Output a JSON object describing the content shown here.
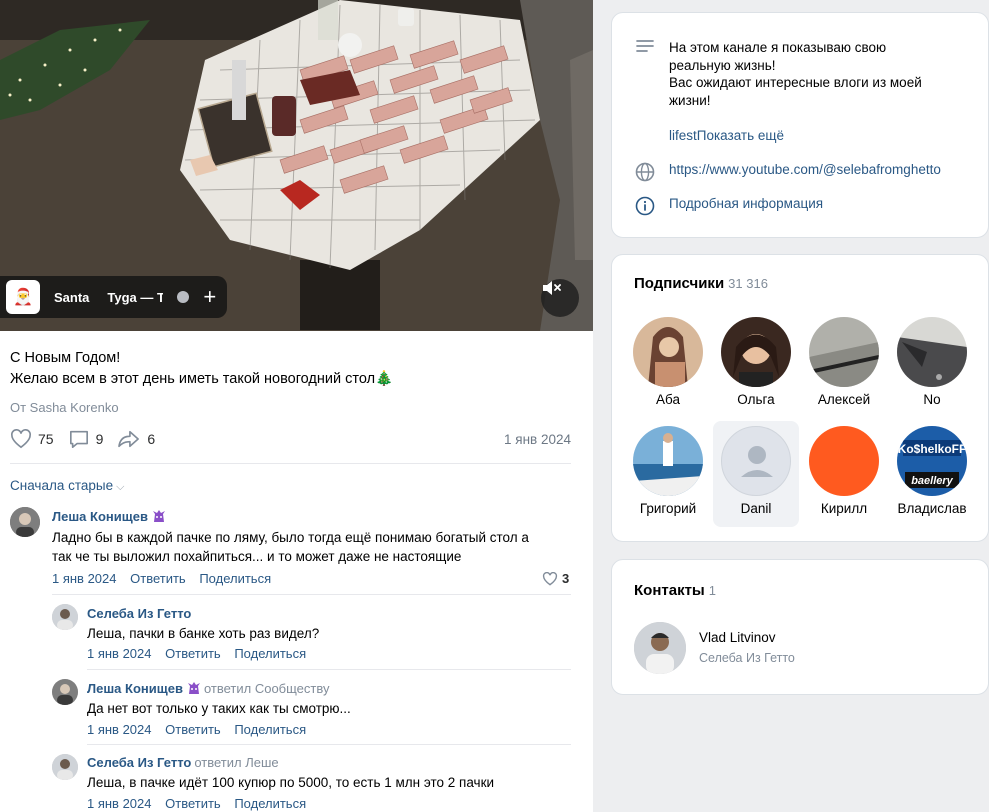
{
  "post": {
    "music": {
      "artist": "Santa",
      "track": "Tyga — T"
    },
    "text_line1": "С Новым Годом!",
    "text_line2": "Желаю всем в этот день иметь такой новогодний стол🎄",
    "author": "От Sasha Korenko",
    "likes": "75",
    "comments": "9",
    "shares": "6",
    "date": "1 янв 2024",
    "sort_label": "Сначала старые"
  },
  "comments": [
    {
      "name": "Леша Конищев",
      "reply_to": "",
      "text_line1": "Ладно бы в каждой пачке по ляму, было тогда ещё понимаю богатый стол а",
      "text_line2": "так че ты выложил похайпиться... и то может даже не настоящие",
      "date": "1 янв 2024",
      "reply": "Ответить",
      "share": "Поделиться",
      "likes": "3"
    },
    {
      "name": "Селеба Из Гетто",
      "reply_to": "",
      "text_line1": "Леша, пачки в банке хоть раз видел?",
      "date": "1 янв 2024",
      "reply": "Ответить",
      "share": "Поделиться"
    },
    {
      "name": "Леша Конищев",
      "reply_to": "ответил Сообществу",
      "text_line1": "Да нет вот только у таких как ты смотрю...",
      "date": "1 янв 2024",
      "reply": "Ответить",
      "share": "Поделиться"
    },
    {
      "name": "Селеба Из Гетто",
      "reply_to": "ответил Леше",
      "text_line1": "Леша, в пачке идёт 100 купюр по 5000, то есть 1 млн это 2 пачки",
      "date": "1 янв 2024",
      "reply": "Ответить",
      "share": "Поделиться"
    }
  ],
  "about": {
    "desc_line1": "На этом канале я показываю свою",
    "desc_line2": "реальную жизнь!",
    "desc_line3": "Вас ожидают интересные влоги из моей",
    "desc_line4": "жизни!",
    "tag": "lifest",
    "show_more": "Показать ещё",
    "url": "https://www.youtube.com/@selebafromghetto",
    "details": "Подробная информация"
  },
  "subscribers": {
    "title": "Подписчики",
    "count": "31 316",
    "people": [
      {
        "name": "Аба",
        "color": "#c9a98a"
      },
      {
        "name": "Ольга",
        "color": "#5a3e30"
      },
      {
        "name": "Алексей",
        "color": "#9a9a94"
      },
      {
        "name": "No",
        "color": "#6e6e70"
      },
      {
        "name": "Григорий",
        "color": "#4a88c0"
      },
      {
        "name": "Danil",
        "color": "#dfe3ea"
      },
      {
        "name": "Кирилл",
        "color": "#ff5a1f"
      },
      {
        "name": "Владислав",
        "color": "#1c5da8"
      }
    ]
  },
  "contacts": {
    "title": "Контакты",
    "count": "1",
    "name": "Vlad Litvinov",
    "role": "Селеба Из Гетто"
  },
  "colors": {
    "link": "#2a5885",
    "muted": "#818c99",
    "bg": "#edeef0"
  }
}
